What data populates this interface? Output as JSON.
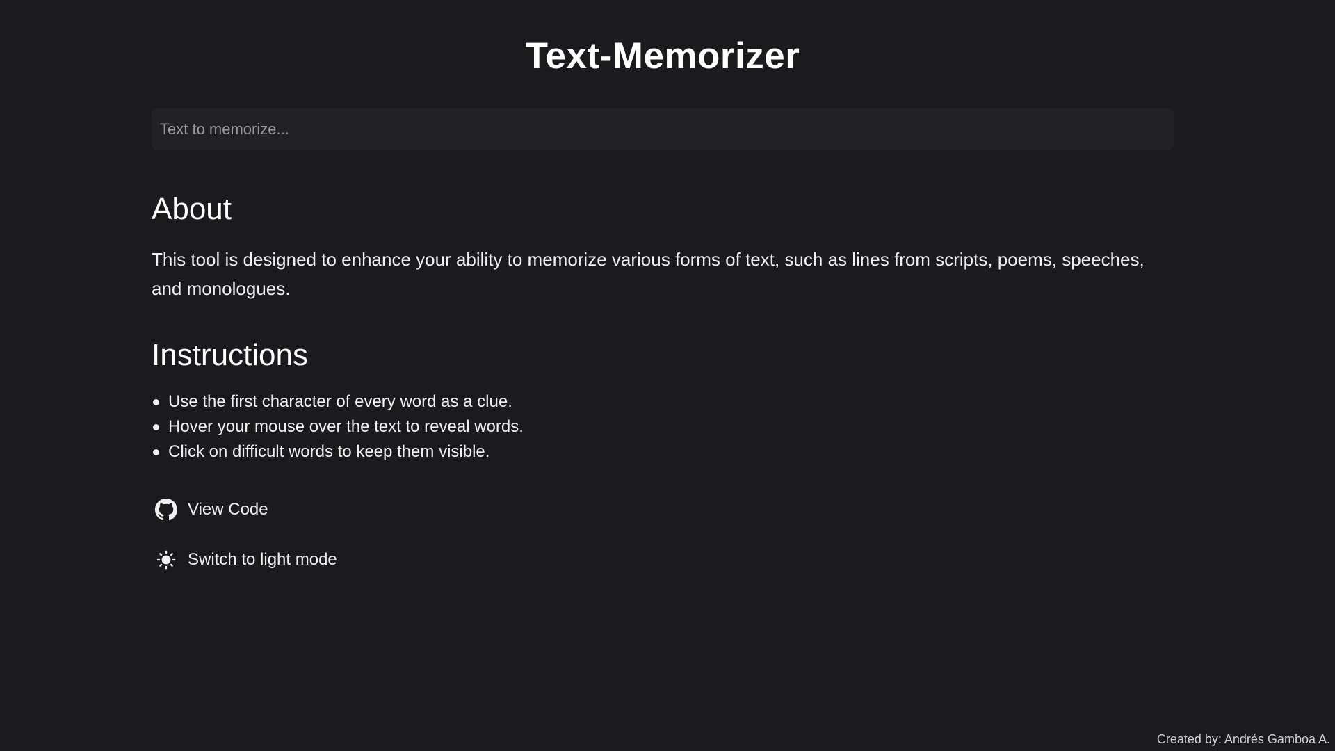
{
  "header": {
    "title": "Text-Memorizer"
  },
  "input": {
    "placeholder": "Text to memorize...",
    "value": ""
  },
  "about": {
    "heading": "About",
    "text": "This tool is designed to enhance your ability to memorize various forms of text, such as lines from scripts, poems, speeches, and monologues."
  },
  "instructions": {
    "heading": "Instructions",
    "items": [
      "Use the first character of every word as a clue.",
      "Hover your mouse over the text to reveal words.",
      "Click on difficult words to keep them visible."
    ]
  },
  "links": {
    "view_code": {
      "label": "View Code",
      "icon": "github-icon"
    },
    "theme_toggle": {
      "label": "Switch to light mode",
      "icon": "sun-icon"
    }
  },
  "footer": {
    "credit": "Created by: Andrés Gamboa A."
  },
  "colors": {
    "background": "#1b1b1d",
    "input_background": "#222225",
    "text": "#f2f2f2"
  }
}
